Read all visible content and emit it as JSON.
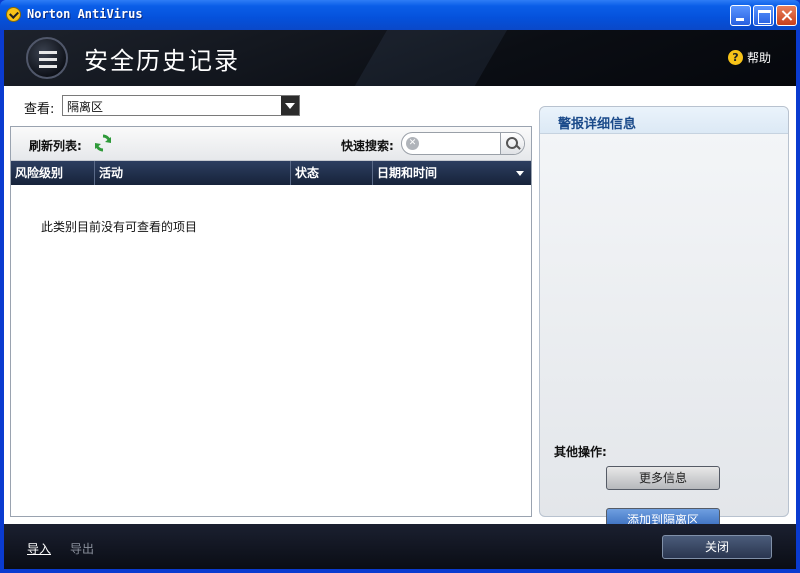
{
  "window": {
    "title": "Norton AntiVirus"
  },
  "header": {
    "title": "安全历史记录",
    "help_label": "帮助"
  },
  "view": {
    "label": "查看:",
    "selected": "隔离区"
  },
  "toolbar": {
    "refresh_label": "刷新列表:",
    "search_label": "快速搜索:",
    "search_value": "",
    "search_placeholder": ""
  },
  "table": {
    "columns": [
      "风险级别",
      "活动",
      "状态",
      "日期和时间"
    ],
    "rows": [],
    "empty_message": "此类别目前没有可查看的项目"
  },
  "details": {
    "title": "警报详细信息",
    "other_actions_label": "其他操作:",
    "more_info_label": "更多信息",
    "add_quarantine_label": "添加到隔离区"
  },
  "footer": {
    "import_label": "导入",
    "export_label": "导出",
    "close_label": "关闭"
  },
  "colors": {
    "titlebar": "#0551db",
    "header_bg": "#0b0e14",
    "table_header": "#1f2e4a",
    "accent_blue": "#2f64b8",
    "norton_yellow": "#f7c318"
  },
  "icons": {
    "app_logo": "norton-check-icon",
    "menu": "menu-list-icon",
    "help": "help-icon",
    "refresh": "refresh-icon",
    "clear": "clear-icon",
    "search": "search-icon",
    "dropdown": "chevron-down-icon",
    "sort": "sort-desc-icon"
  }
}
